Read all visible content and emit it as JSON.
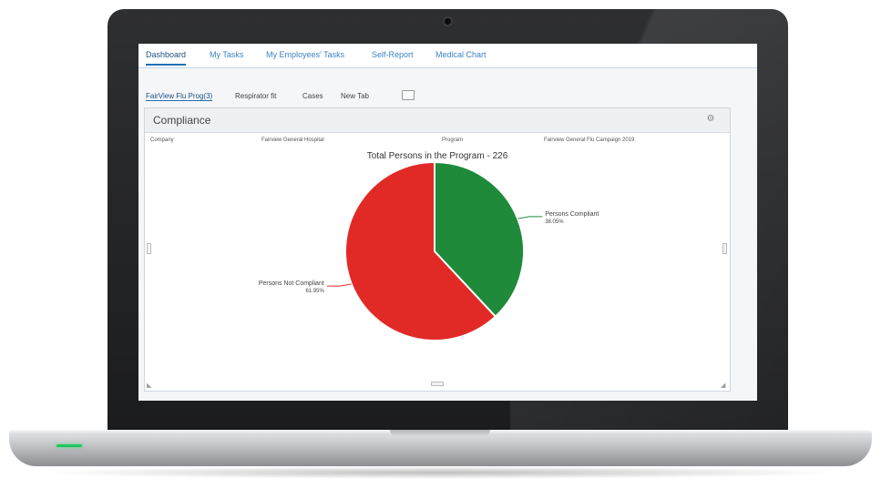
{
  "top_tabs": [
    {
      "label": "Dashboard"
    },
    {
      "label": "My Tasks"
    },
    {
      "label": "My Employees' Tasks"
    },
    {
      "label": "Self-Report"
    },
    {
      "label": "Medical Chart"
    }
  ],
  "sub_tabs": [
    {
      "label": "FairView Flu Prog(3)"
    },
    {
      "label": "Respirator fit"
    },
    {
      "label": "Cases"
    },
    {
      "label": "New Tab"
    }
  ],
  "panel": {
    "title": "Compliance",
    "info": {
      "company_label": "Company",
      "company_value": "Fairview General Hospital",
      "program_label": "Program",
      "program_value": "Fairview General Flu Campaign 2019"
    }
  },
  "chart_data": {
    "type": "pie",
    "title": "Total Persons in the Program - 226",
    "slices": [
      {
        "label": "Persons Compliant",
        "value": 38.05,
        "display": "38.05%",
        "color": "#1e8a3a"
      },
      {
        "label": "Persons Not Compliant",
        "value": 61.95,
        "display": "61.95%",
        "color": "#e12a26"
      }
    ]
  }
}
